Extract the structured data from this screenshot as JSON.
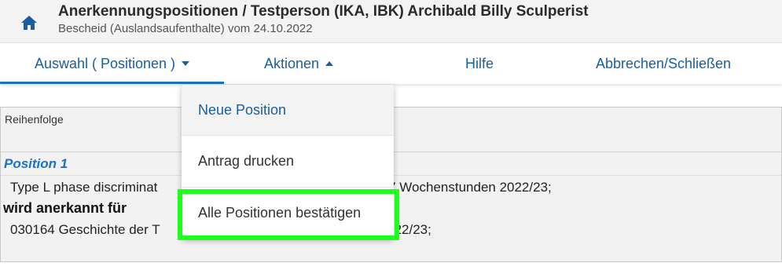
{
  "header": {
    "title": "Anerkennungspositionen  / Testperson (IKA, IBK) Archibald Billy Sculperist",
    "subtitle": "Bescheid (Auslandsaufenthalte) vom 24.10.2022",
    "home_icon": "home-icon"
  },
  "nav": {
    "items": [
      {
        "label": "Auswahl ( Positionen )",
        "caret": "down"
      },
      {
        "label": "Aktionen",
        "caret": "up"
      },
      {
        "label": "Hilfe"
      },
      {
        "label": "Abbrechen/Schließen"
      }
    ],
    "accent_color": "#1a73c8",
    "text_color": "#1a5e9c"
  },
  "dropdown": {
    "items": [
      {
        "label": "Neue Position"
      },
      {
        "label": "Antrag drucken"
      },
      {
        "label": "Alle Positionen bestätigen"
      }
    ],
    "highlight_color": "#1eff1e"
  },
  "content": {
    "reihenfolge_label": "Reihenfolge",
    "position_heading": "Position 1",
    "line1_left": "Type L phase discriminat",
    "line1_right": "ns III; PS 7 Wochenstunden 2022/23;",
    "recognized_label": "wird anerkannt für",
    "line2_left": "030164 Geschichte der T",
    "line2_right": "22/23;"
  }
}
